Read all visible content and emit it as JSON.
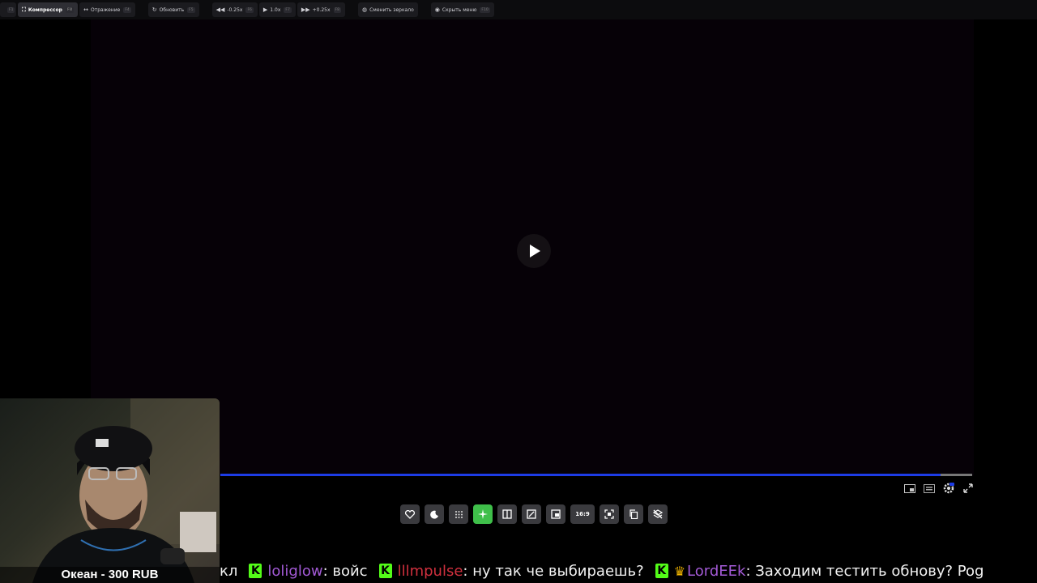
{
  "toolbar": {
    "items": [
      {
        "label": "",
        "key": "F1"
      },
      {
        "label": "Компрессор",
        "key": "F8",
        "icon": "compress-icon"
      },
      {
        "label": "Отражение",
        "key": "F4",
        "icon": "mirror-icon"
      },
      {
        "label": "Обновить",
        "key": "F5",
        "icon": "refresh-icon"
      },
      {
        "label": "-0.25x",
        "key": "F6",
        "icon": "rewind-icon"
      },
      {
        "label": "1.0x",
        "key": "F7",
        "icon": "play-icon"
      },
      {
        "label": "+0.25x",
        "key": "F8",
        "icon": "forward-icon"
      },
      {
        "label": "Сменить зеркало",
        "icon": "globe-icon"
      },
      {
        "label": "Скрыть меню",
        "key": "F10",
        "icon": "eye-icon"
      }
    ]
  },
  "player": {
    "progress": 0.958,
    "accent": "#1d3ce6"
  },
  "iconbar": {
    "aspect_label": "16:9",
    "icons": [
      "heart-icon",
      "moon-icon",
      "grid-icon",
      "sparkle-icon",
      "split-icon",
      "resize-icon",
      "pip-icon",
      "aspect-icon",
      "focus-icon",
      "copy-icon",
      "layers-off-icon"
    ]
  },
  "webcam": {
    "caption": "Океан - 300 RUB"
  },
  "chat": {
    "messages": [
      {
        "user": "",
        "text": "кл"
      },
      {
        "user": "loliglow",
        "user_color": "#a35ad6",
        "text": ": войс"
      },
      {
        "user": "lllmpulse",
        "user_color": "#d0303e",
        "text": ": ну так че выбираешь?"
      },
      {
        "user": "LordEEk",
        "user_color": "#a35ad6",
        "crown": true,
        "text": ": Заходим тестить обнову? Pog"
      }
    ]
  }
}
